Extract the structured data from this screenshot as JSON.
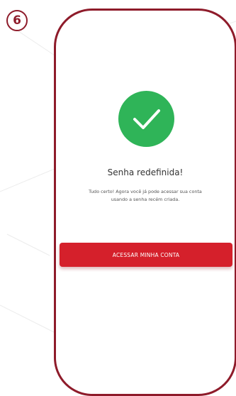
{
  "step": {
    "number": "6"
  },
  "screen": {
    "icon": "check-circle-icon",
    "title": "Senha redefinida!",
    "message_line1": "Tudo certo! Agora você já pode acessar sua conta",
    "message_line2": "usando a senha recém criada.",
    "button_label": "ACESSAR MINHA CONTA"
  },
  "colors": {
    "frame": "#8e1b2a",
    "success": "#2fb458",
    "button": "#d5202b"
  }
}
